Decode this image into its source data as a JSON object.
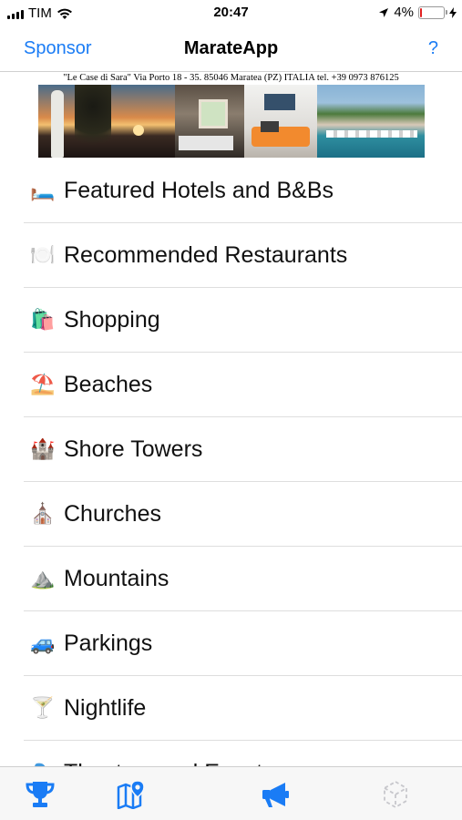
{
  "status_bar": {
    "carrier": "TIM",
    "time": "20:47",
    "battery_percent_text": "4%",
    "battery_level": 0.04,
    "signal_icon": "signal-bars-icon",
    "wifi_icon": "wifi-icon",
    "location_icon": "location-arrow-icon",
    "charging_icon": "bolt-icon"
  },
  "nav": {
    "left_label": "Sponsor",
    "title": "MarateApp",
    "right_label": "?",
    "accent_color": "#1a7cf5"
  },
  "banner": {
    "caption": "\"Le Case di Sara\" Via Porto 18 - 35. 85046 Maratea (PZ) ITALIA tel. +39 0973 876125"
  },
  "menu": {
    "items": [
      {
        "emoji": "🛏️",
        "icon": "bed-icon",
        "label": "Featured Hotels and B&Bs"
      },
      {
        "emoji": "🍽️",
        "icon": "plate-cutlery-icon",
        "label": "Recommended Restaurants"
      },
      {
        "emoji": "🛍️",
        "icon": "shopping-bags-icon",
        "label": "Shopping"
      },
      {
        "emoji": "⛱️",
        "icon": "beach-umbrella-icon",
        "label": "Beaches"
      },
      {
        "emoji": "🏰",
        "icon": "castle-icon",
        "label": "Shore Towers"
      },
      {
        "emoji": "⛪",
        "icon": "church-icon",
        "label": "Churches"
      },
      {
        "emoji": "⛰️",
        "icon": "mountain-icon",
        "label": "Mountains"
      },
      {
        "emoji": "🚙",
        "icon": "car-icon",
        "label": "Parkings"
      },
      {
        "emoji": "🍸",
        "icon": "cocktail-icon",
        "label": "Nightlife"
      },
      {
        "emoji": "🎭",
        "icon": "theater-icon",
        "label": "Theaters and Events"
      }
    ]
  },
  "tab_bar": {
    "tabs": [
      {
        "icon": "trophy-icon",
        "active": true
      },
      {
        "icon": "map-pin-icon",
        "active": true
      },
      {
        "icon": "megaphone-icon",
        "active": true
      },
      {
        "icon": "ar-cube-icon",
        "active": false
      }
    ],
    "active_color": "#1a7cf5",
    "inactive_color": "#c7c7cc"
  }
}
